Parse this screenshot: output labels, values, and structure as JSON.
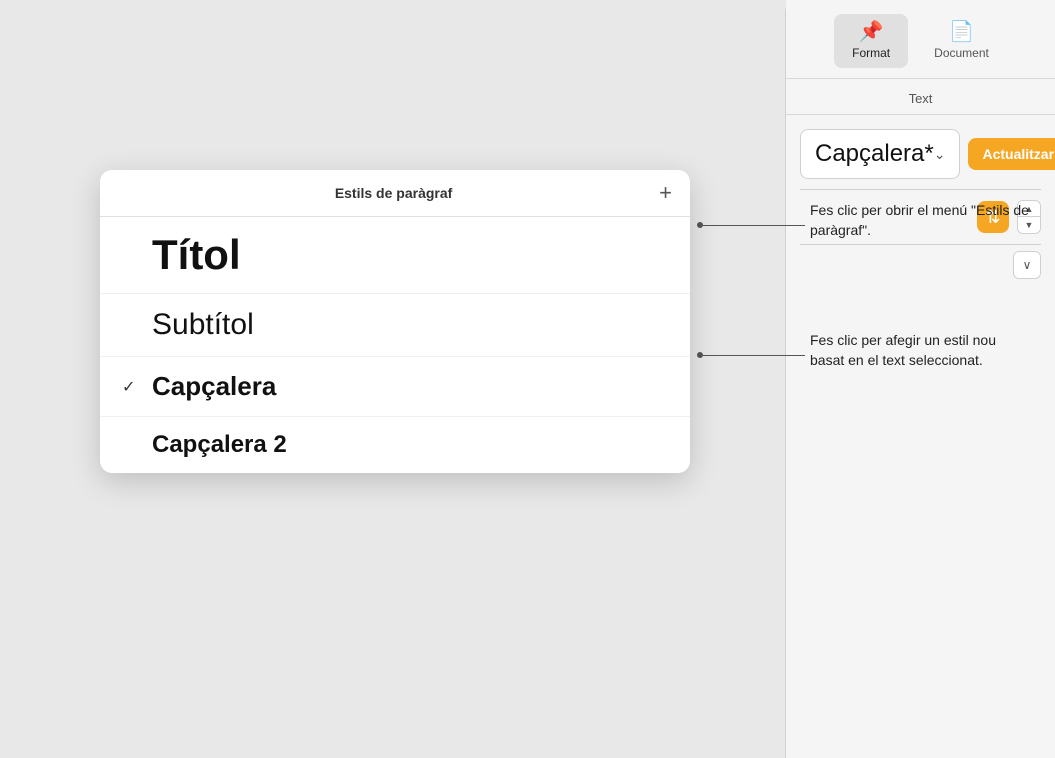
{
  "sidebar": {
    "tabs": [
      {
        "id": "format",
        "label": "Format",
        "icon": "📌",
        "active": true
      },
      {
        "id": "document",
        "label": "Document",
        "icon": "📄",
        "active": false
      }
    ],
    "section_title": "Text",
    "style_selector_text": "Capçalera*",
    "update_button_label": "Actualitzar"
  },
  "para_styles_panel": {
    "title": "Estils de paràgraf",
    "add_button_label": "+",
    "items": [
      {
        "id": "titol",
        "label": "Títol",
        "checked": false
      },
      {
        "id": "subtitol",
        "label": "Subtítol",
        "checked": false
      },
      {
        "id": "capcalera",
        "label": "Capçalera",
        "checked": true
      },
      {
        "id": "capcalera2",
        "label": "Capçalera 2",
        "checked": false
      }
    ]
  },
  "annotations": {
    "annotation1": {
      "text": "Fes clic per obrir el menú \"Estils de paràgraf\"."
    },
    "annotation2": {
      "text": "Fes clic per afegir un estil nou basat en el text seleccionat."
    }
  },
  "icons": {
    "format_icon": "📌",
    "document_icon": "📄",
    "chevron_down": "⌄",
    "check_mark": "✓",
    "plus": "+",
    "up_arrow": "▲",
    "down_arrow": "▼",
    "chevron_right": "›"
  }
}
